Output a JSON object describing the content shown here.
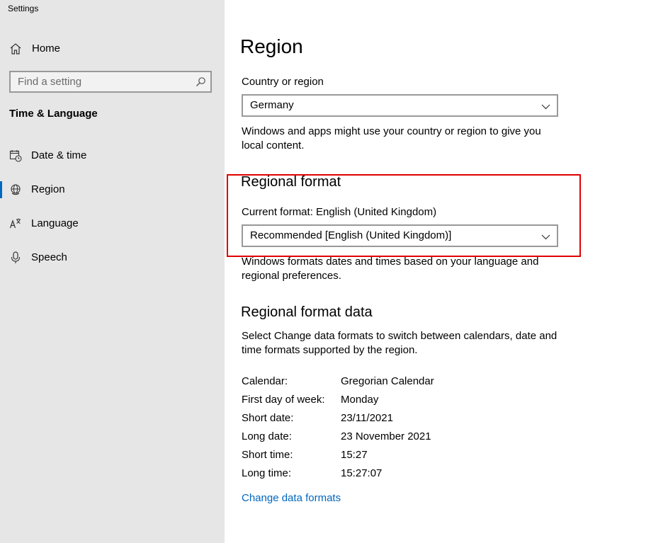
{
  "app": {
    "title": "Settings"
  },
  "sidebar": {
    "home_label": "Home",
    "search_placeholder": "Find a setting",
    "section_title": "Time & Language",
    "items": [
      {
        "label": "Date & time",
        "icon": "calendar-clock-icon"
      },
      {
        "label": "Region",
        "icon": "globe-icon",
        "active": true
      },
      {
        "label": "Language",
        "icon": "language-icon"
      },
      {
        "label": "Speech",
        "icon": "microphone-icon"
      }
    ]
  },
  "main": {
    "title": "Region",
    "country": {
      "label": "Country or region",
      "value": "Germany",
      "description_line1": "Windows and apps might use your country or region to give you",
      "description_line2": "local content."
    },
    "regional_format": {
      "heading": "Regional format",
      "current": "Current format: English (United Kingdom)",
      "value": "Recommended [English (United Kingdom)]",
      "description_line1": "Windows formats dates and times based on your language and",
      "description_line2": "regional preferences."
    },
    "regional_format_data": {
      "heading": "Regional format data",
      "description_line1": "Select Change data formats to switch between calendars, date and",
      "description_line2": "time formats supported by the region.",
      "rows": [
        {
          "key": "Calendar:",
          "value": "Gregorian Calendar"
        },
        {
          "key": "First day of week:",
          "value": "Monday"
        },
        {
          "key": "Short date:",
          "value": "23/11/2021"
        },
        {
          "key": "Long date:",
          "value": "23 November 2021"
        },
        {
          "key": "Short time:",
          "value": "15:27"
        },
        {
          "key": "Long time:",
          "value": "15:27:07"
        }
      ],
      "change_link": "Change data formats"
    }
  },
  "colors": {
    "accent": "#0067c0",
    "highlight": "#e00000",
    "sidebar_bg": "#e6e6e6"
  }
}
